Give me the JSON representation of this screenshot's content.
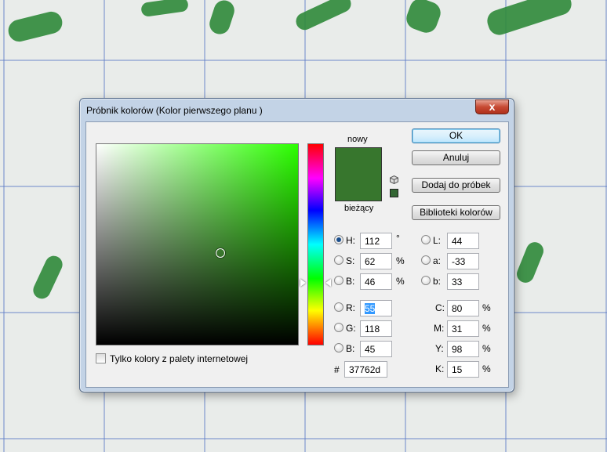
{
  "dialog": {
    "title": "Próbnik kolorów (Kolor pierwszego planu )",
    "close_label": "x"
  },
  "swatch": {
    "new_label": "nowy",
    "current_label": "bieżący",
    "color": "#37762d"
  },
  "buttons": {
    "ok": "OK",
    "cancel": "Anuluj",
    "add_to_swatches": "Dodaj do próbek",
    "color_libraries": "Biblioteki kolorów"
  },
  "hsb": {
    "h_label": "H:",
    "h_value": "112",
    "h_unit": "°",
    "s_label": "S:",
    "s_value": "62",
    "s_unit": "%",
    "b_label": "B:",
    "b_value": "46",
    "b_unit": "%"
  },
  "rgb": {
    "r_label": "R:",
    "r_value": "55",
    "g_label": "G:",
    "g_value": "118",
    "b_label": "B:",
    "b_value": "45"
  },
  "lab": {
    "l_label": "L:",
    "l_value": "44",
    "a_label": "a:",
    "a_value": "-33",
    "b_label": "b:",
    "b_value": "33"
  },
  "cmyk": {
    "c_label": "C:",
    "c_value": "80",
    "c_unit": "%",
    "m_label": "M:",
    "m_value": "31",
    "m_unit": "%",
    "y_label": "Y:",
    "y_value": "98",
    "y_unit": "%",
    "k_label": "K:",
    "k_value": "15",
    "k_unit": "%"
  },
  "hex": {
    "label": "#",
    "value": "37762d"
  },
  "web_only": {
    "label": "Tylko kolory z palety internetowej",
    "checked": false
  },
  "colors": {
    "picker_hue": "#2bff00",
    "dialog_frame": "#c3d3e6",
    "client_bg": "#f0f0f0"
  }
}
